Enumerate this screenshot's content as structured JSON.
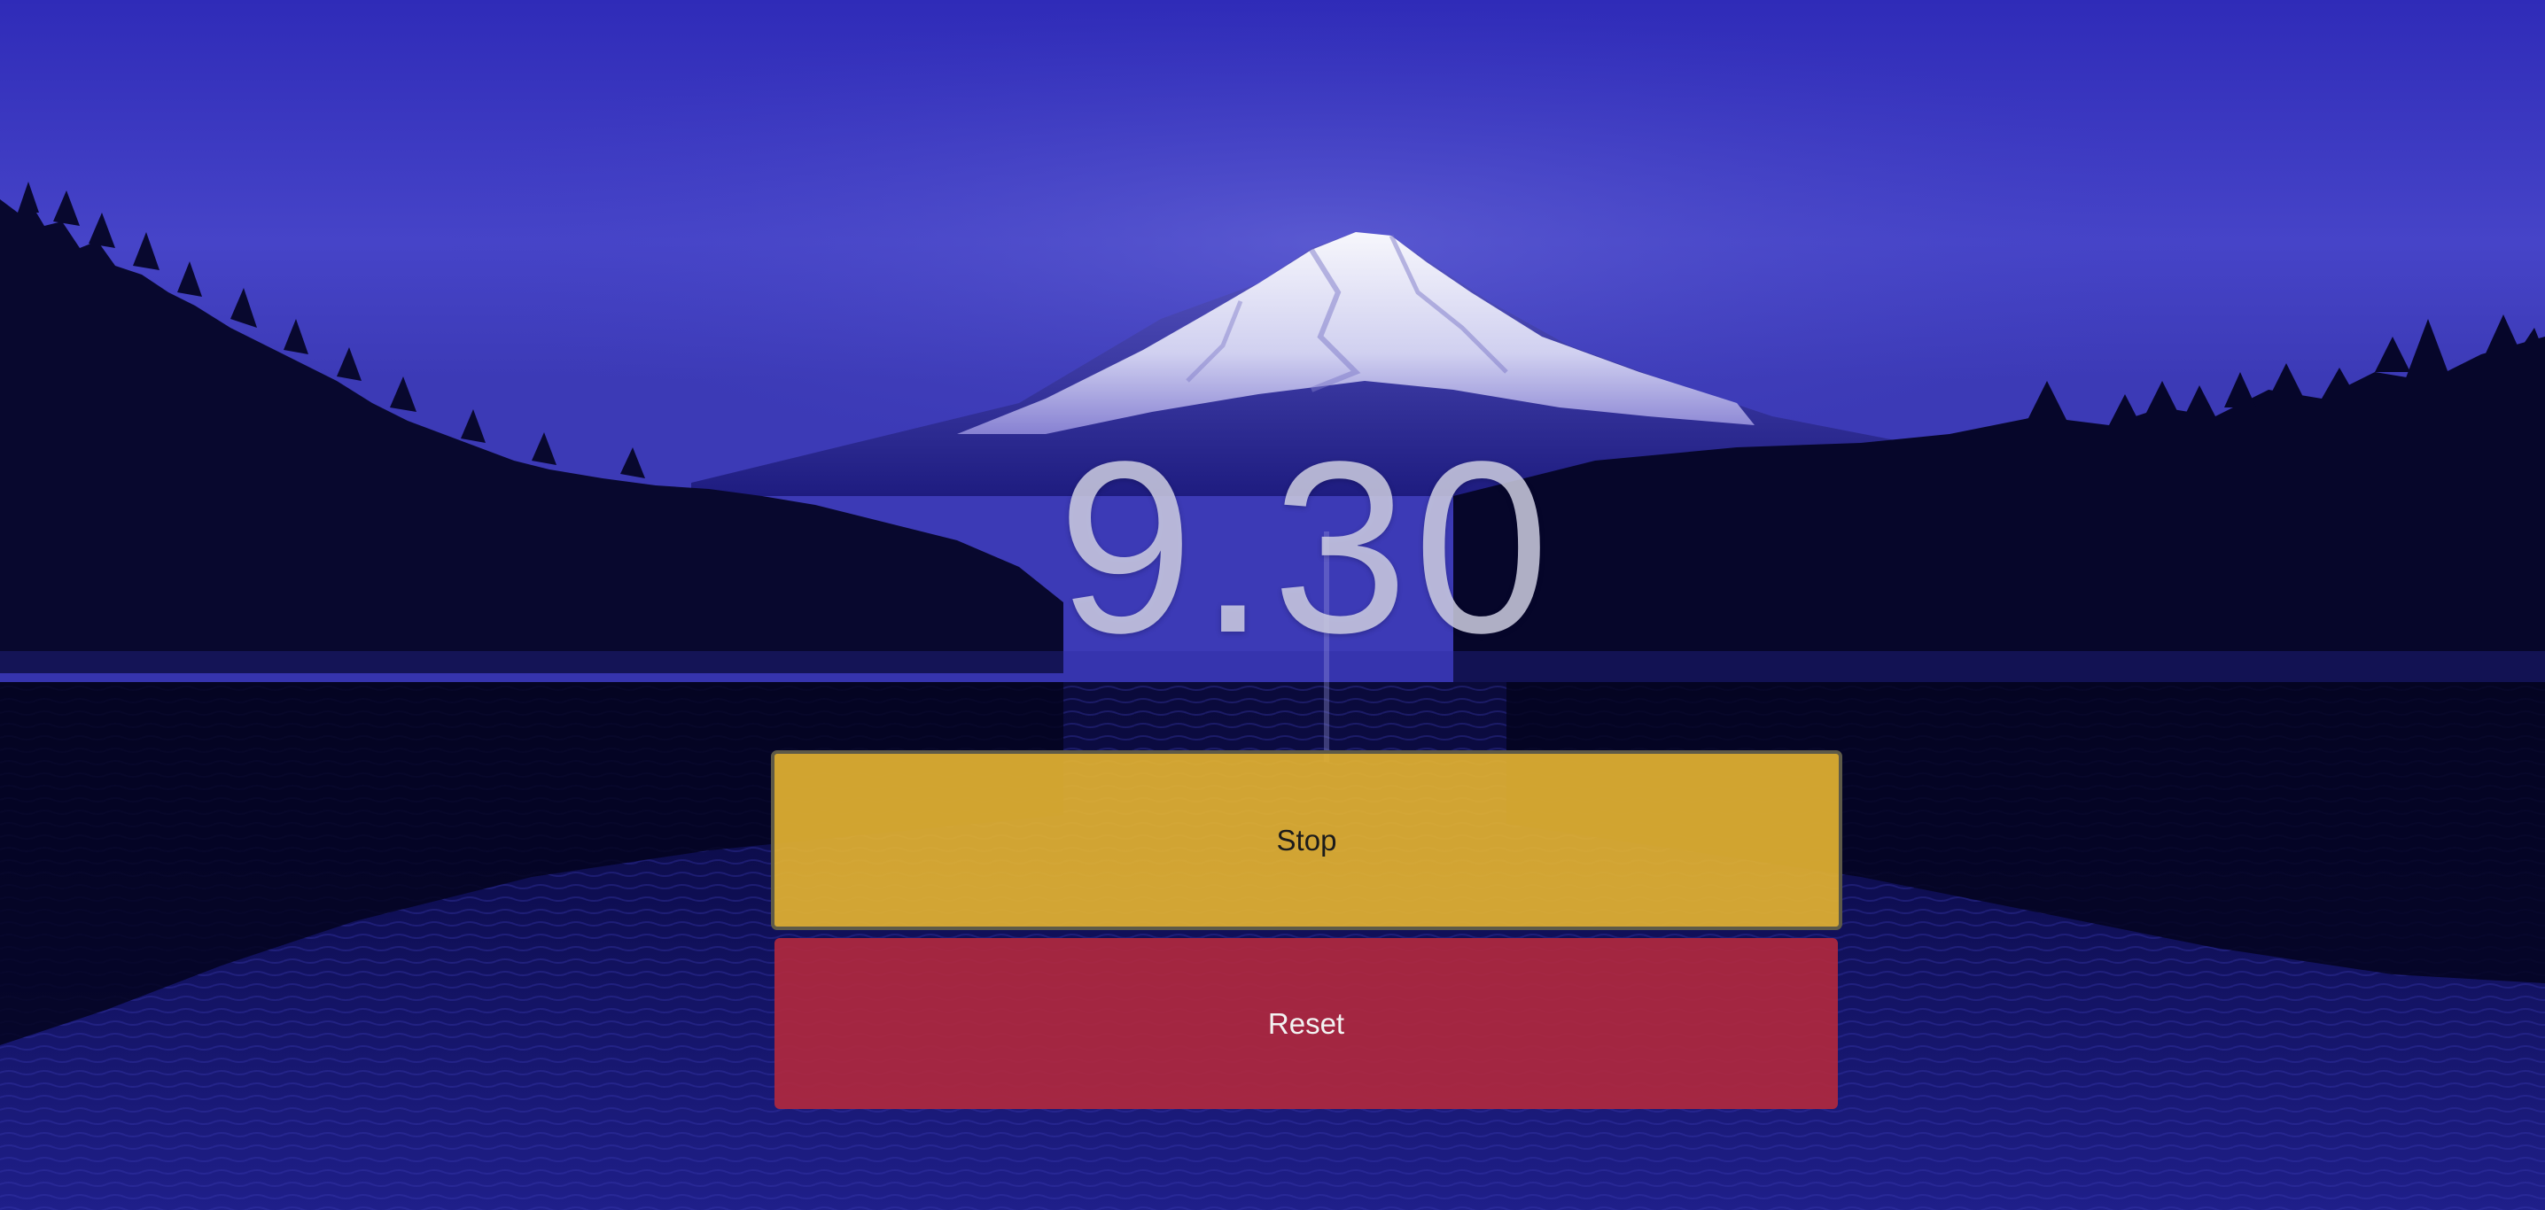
{
  "timer": {
    "value": "9.30"
  },
  "buttons": {
    "stop_label": "Stop",
    "reset_label": "Reset"
  },
  "background": {
    "image": "mountain-lake-night-image"
  },
  "colors": {
    "sky": "#3a36c4",
    "stop_button": "#e1b032",
    "reset_button": "#b0283e",
    "timer_text": "#d6d6e8"
  }
}
